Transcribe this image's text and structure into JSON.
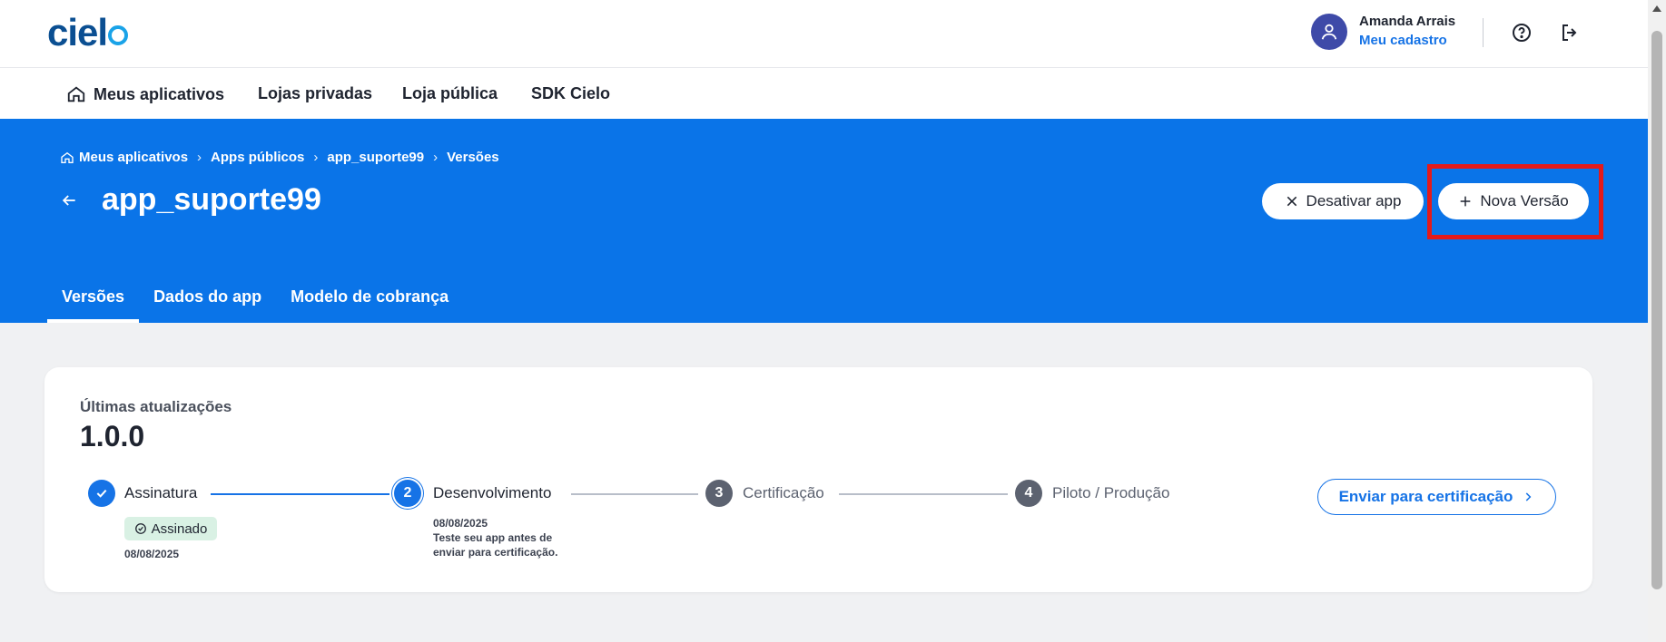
{
  "header": {
    "logo": "cielo",
    "user_name": "Amanda Arrais",
    "user_link": "Meu cadastro"
  },
  "nav": {
    "items": [
      "Meus aplicativos",
      "Lojas privadas",
      "Loja pública",
      "SDK Cielo"
    ]
  },
  "breadcrumb": [
    "Meus aplicativos",
    "Apps públicos",
    "app_suporte99",
    "Versões"
  ],
  "page": {
    "title": "app_suporte99",
    "deactivate_label": "Desativar app",
    "new_version_label": "Nova Versão"
  },
  "tabs": [
    "Versões",
    "Dados do app",
    "Modelo de cobrança"
  ],
  "card": {
    "subtitle": "Últimas atualizações",
    "version": "1.0.0",
    "steps": [
      {
        "number": "✓",
        "label": "Assinatura",
        "status": "done"
      },
      {
        "number": "2",
        "label": "Desenvolvimento",
        "status": "current"
      },
      {
        "number": "3",
        "label": "Certificação",
        "status": "pending"
      },
      {
        "number": "4",
        "label": "Piloto / Produção",
        "status": "pending"
      }
    ],
    "badge": "Assinado",
    "signed_date": "08/08/2025",
    "dev_date": "08/08/2025",
    "dev_note_1": "Teste seu app antes de",
    "dev_note_2": "enviar para certificação.",
    "send_button": "Enviar para certificação"
  },
  "colors": {
    "brand_blue": "#0a74e8",
    "accent": "#1673e6",
    "highlight": "#e41a1a"
  }
}
